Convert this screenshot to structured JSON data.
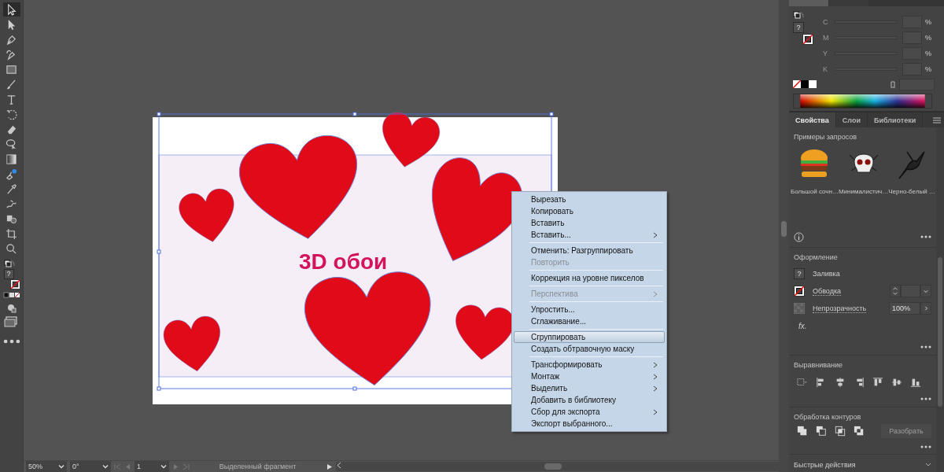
{
  "tools": [
    {
      "kind": "selection",
      "selected": true
    },
    {
      "kind": "direct-selection",
      "selected": false
    },
    {
      "kind": "pen",
      "selected": false
    },
    {
      "kind": "curvature",
      "selected": false
    },
    {
      "kind": "rectangle",
      "selected": false
    },
    {
      "kind": "brush",
      "selected": false
    },
    {
      "kind": "type",
      "selected": false
    },
    {
      "kind": "rotate",
      "selected": false
    },
    {
      "kind": "eraser",
      "selected": false
    },
    {
      "kind": "lasso",
      "selected": false
    },
    {
      "kind": "gradient",
      "selected": false
    },
    {
      "kind": "puppet",
      "selected": false
    },
    {
      "kind": "eyedropper",
      "selected": false
    },
    {
      "kind": "warp",
      "selected": false
    },
    {
      "kind": "shapes",
      "selected": false
    },
    {
      "kind": "crop",
      "selected": false
    },
    {
      "kind": "zoom",
      "selected": false
    }
  ],
  "toolbar_fill_swatch": "?",
  "canvas": {
    "artboard_text": "3D обои"
  },
  "context_menu": {
    "items": [
      {
        "kind": "item",
        "label": "Вырезать",
        "disabled": false,
        "submenu": false,
        "selected": false
      },
      {
        "kind": "item",
        "label": "Копировать",
        "disabled": false,
        "submenu": false,
        "selected": false
      },
      {
        "kind": "item",
        "label": "Вставить",
        "disabled": false,
        "submenu": false,
        "selected": false
      },
      {
        "kind": "item",
        "label": "Вставить...",
        "disabled": false,
        "submenu": true,
        "selected": false
      },
      {
        "kind": "separator"
      },
      {
        "kind": "item",
        "label": "Отменить: Разгруппировать",
        "disabled": false,
        "submenu": false,
        "selected": false
      },
      {
        "kind": "item",
        "label": "Повторить",
        "disabled": true,
        "submenu": false,
        "selected": false
      },
      {
        "kind": "separator"
      },
      {
        "kind": "item",
        "label": "Коррекция на уровне пикселов",
        "disabled": false,
        "submenu": false,
        "selected": false
      },
      {
        "kind": "separator"
      },
      {
        "kind": "item",
        "label": "Перспектива",
        "disabled": true,
        "submenu": true,
        "selected": false
      },
      {
        "kind": "separator"
      },
      {
        "kind": "item",
        "label": "Упростить...",
        "disabled": false,
        "submenu": false,
        "selected": false
      },
      {
        "kind": "item",
        "label": "Сглаживание...",
        "disabled": false,
        "submenu": false,
        "selected": false
      },
      {
        "kind": "separator"
      },
      {
        "kind": "item",
        "label": "Сгруппировать",
        "disabled": false,
        "submenu": false,
        "selected": true
      },
      {
        "kind": "item",
        "label": "Создать обтравочную маску",
        "disabled": false,
        "submenu": false,
        "selected": false
      },
      {
        "kind": "separator"
      },
      {
        "kind": "item",
        "label": "Трансформировать",
        "disabled": false,
        "submenu": true,
        "selected": false
      },
      {
        "kind": "item",
        "label": "Монтаж",
        "disabled": false,
        "submenu": true,
        "selected": false
      },
      {
        "kind": "item",
        "label": "Выделить",
        "disabled": false,
        "submenu": true,
        "selected": false
      },
      {
        "kind": "item",
        "label": "Добавить в библиотеку",
        "disabled": false,
        "submenu": false,
        "selected": false
      },
      {
        "kind": "item",
        "label": "Сбор для экспорта",
        "disabled": false,
        "submenu": true,
        "selected": false
      },
      {
        "kind": "item",
        "label": "Экспорт выбранного...",
        "disabled": false,
        "submenu": false,
        "selected": false
      }
    ]
  },
  "status_bar": {
    "zoom": "50%",
    "rotation": "0°",
    "artboard": "1",
    "status": "Выделенный фрагмент"
  },
  "color_panel": {
    "tabs": [
      {
        "selected": true
      },
      {
        "selected": false
      }
    ],
    "fill_swatch": "?",
    "channels": [
      {
        "label": "C",
        "unit": "%"
      },
      {
        "label": "M",
        "unit": "%"
      },
      {
        "label": "Y",
        "unit": "%"
      },
      {
        "label": "K",
        "unit": "%"
      }
    ]
  },
  "properties_panel": {
    "tabs": [
      {
        "label": "Свойства",
        "selected": true
      },
      {
        "label": "Слои",
        "selected": false
      },
      {
        "label": "Библиотеки",
        "selected": false
      }
    ],
    "samples_title": "Примеры запросов",
    "samples": [
      {
        "kind": "burger",
        "caption": "Большой сочн…"
      },
      {
        "kind": "skull",
        "caption": "Минималистич…"
      },
      {
        "kind": "bird",
        "caption": "Черно-белый …"
      }
    ],
    "appearance": {
      "title": "Оформление",
      "fill_swatch": "?",
      "fill_label": "Заливка",
      "stroke_label": "Обводка",
      "opacity_label": "Непрозрачность",
      "opacity_value": "100%",
      "effects_label": "fx."
    },
    "align_title": "Выравнивание",
    "pathfinder": {
      "title": "Обработка контуров",
      "button": "Разобрать",
      "button_disabled": true
    },
    "quick_actions_title": "Быстрые действия"
  }
}
